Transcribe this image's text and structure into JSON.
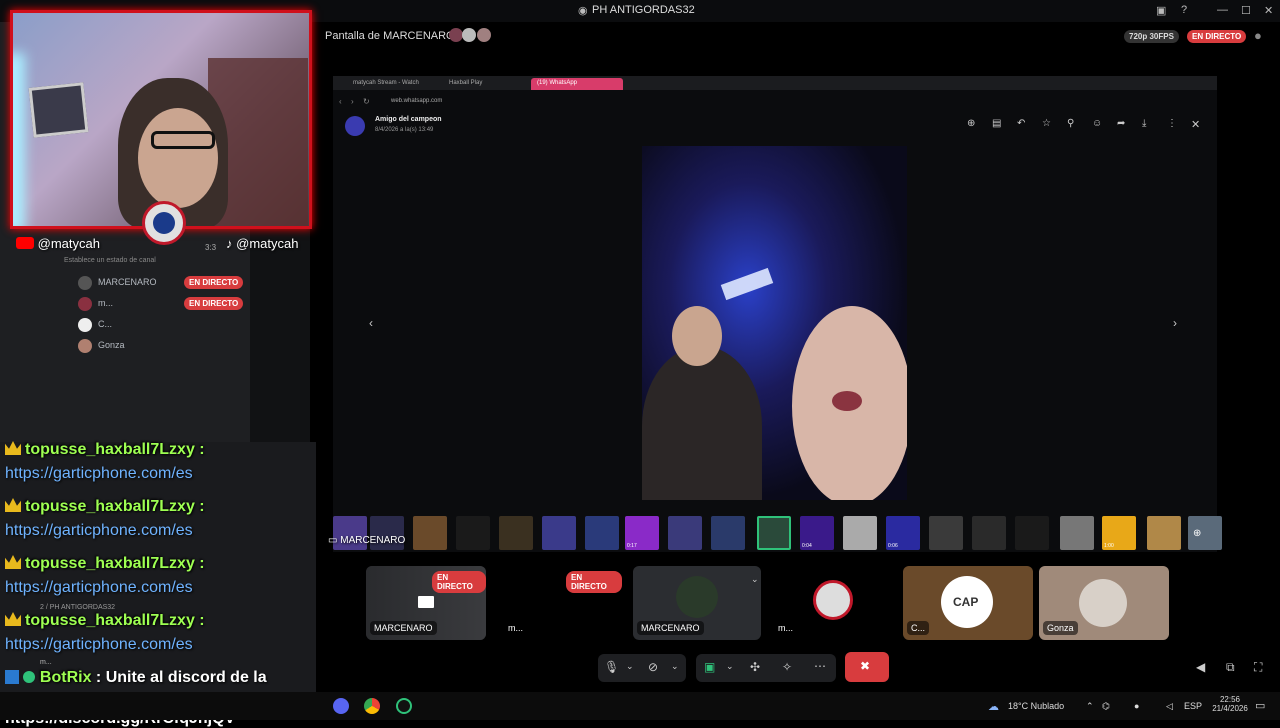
{
  "window": {
    "title": "PH ANTIGORDAS32"
  },
  "stream_header": {
    "title": "Pantalla de MARCENARO",
    "quality": "720p 30FPS",
    "live_badge": "EN DIRECTO"
  },
  "sidebar": {
    "status_hint": "Establece un estado de canal",
    "members": [
      {
        "name": "MARCENARO",
        "badge": "EN DIRECTO"
      },
      {
        "name": "m...",
        "badge": "EN DIRECTO"
      },
      {
        "name": "C...",
        "badge": ""
      },
      {
        "name": "Gonza",
        "badge": ""
      }
    ],
    "voice_channel": "2 / PH ANTIGORDAS32",
    "user_short": "m..."
  },
  "overlay": {
    "youtube_handle": "@matycah",
    "tiktok_handle": "@matycah",
    "timer": "3:3"
  },
  "browser": {
    "tabs": [
      "matycah Stream - Watch",
      "Haxball Play",
      "(19) WhatsApp"
    ],
    "url": "web.whatsapp.com",
    "chat_title": "Amigo del campeon",
    "chat_time": "8/4/2026 a la(s) 13:49"
  },
  "thumbnail_strip": {
    "label": "MARCENARO",
    "durations": [
      "0:17",
      "0:04",
      "0:06",
      "1:00"
    ]
  },
  "chat": [
    {
      "user": "topusse_haxball7Lzxy :",
      "message": "https://garticphone.com/es"
    },
    {
      "user": "topusse_haxball7Lzxy :",
      "message": "https://garticphone.com/es"
    },
    {
      "user": "topusse_haxball7Lzxy :",
      "message": "https://garticphone.com/es"
    },
    {
      "user": "topusse_haxball7Lzxy :",
      "message": "https://garticphone.com/es"
    }
  ],
  "botrix": {
    "name": "BotRix",
    "message_line1": ": Unite al discord de la",
    "message_line2": "comunidad https://discord.gg/RrCfqJhjQV"
  },
  "tiles": [
    {
      "label": "MARCENARO",
      "badge": "EN DIRECTO"
    },
    {
      "label": "m...",
      "badge": "EN DIRECTO"
    },
    {
      "label": "MARCENARO",
      "badge": ""
    },
    {
      "label": "m...",
      "badge": ""
    },
    {
      "label": "C...",
      "badge": ""
    },
    {
      "label": "Gonza",
      "badge": ""
    }
  ],
  "taskbar": {
    "weather": "18°C  Nublado",
    "language": "ESP",
    "time": "22:56",
    "date": "21/4/2026"
  },
  "colors": {
    "live": "#d83c3e",
    "chat_user": "#9eff52",
    "chat_link": "#6fb3ff",
    "webcam_border": "#d0101c"
  }
}
